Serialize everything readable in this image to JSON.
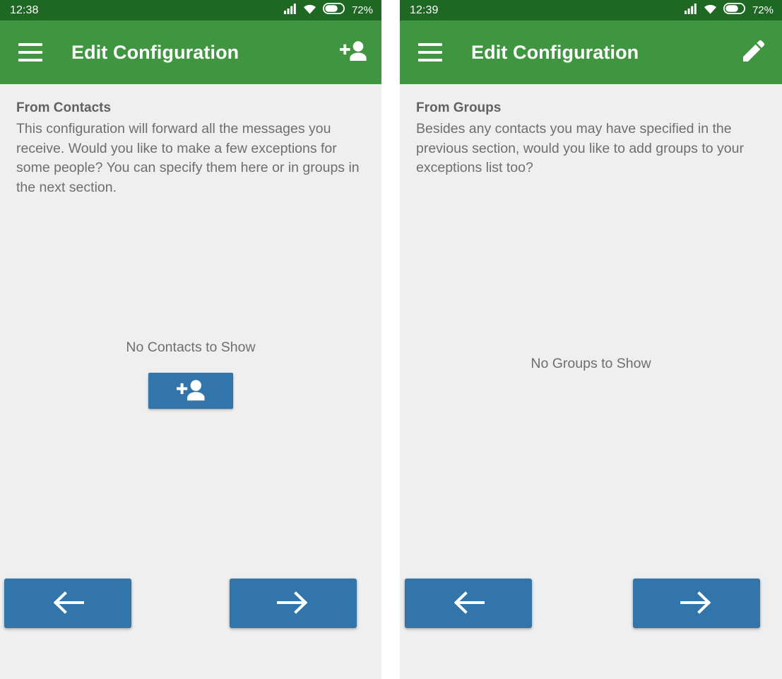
{
  "screens": [
    {
      "id": "from-contacts-screen",
      "status_bar": {
        "time": "12:38",
        "battery_text": "72%",
        "signal_icon": "signal-bars-icon",
        "wifi_icon": "wifi-icon",
        "battery_icon": "battery-icon"
      },
      "app_bar": {
        "menu_icon": "hamburger-menu-icon",
        "title": "Edit Configuration",
        "action_icon": "add-person-icon"
      },
      "section": {
        "title": "From Contacts",
        "description": "This configuration will forward all the messages you receive. Would you like to make a few exceptions for some people? You can specify them here or in groups in the next section."
      },
      "empty_state": {
        "text": "No Contacts to Show",
        "button_icon": "add-person-icon"
      },
      "nav": {
        "prev_icon": "arrow-left-icon",
        "next_icon": "arrow-right-icon"
      }
    },
    {
      "id": "from-groups-screen",
      "status_bar": {
        "time": "12:39",
        "battery_text": "72%",
        "signal_icon": "signal-bars-icon",
        "wifi_icon": "wifi-icon",
        "battery_icon": "battery-icon"
      },
      "app_bar": {
        "menu_icon": "hamburger-menu-icon",
        "title": "Edit Configuration",
        "action_icon": "edit-pencil-icon"
      },
      "section": {
        "title": "From Groups",
        "description": "Besides any contacts you may have specified in the previous section, would you like to add groups to your exceptions list too?"
      },
      "empty_state": {
        "text": "No Groups to Show"
      },
      "nav": {
        "prev_icon": "arrow-left-icon",
        "next_icon": "arrow-right-icon"
      }
    }
  ],
  "colors": {
    "status_bar_green": "#1f6823",
    "app_bar_green": "#409640",
    "content_background": "#efefef",
    "button_blue": "#3275ab",
    "text_grey": "#6e6e6e",
    "heading_grey": "#616161"
  }
}
